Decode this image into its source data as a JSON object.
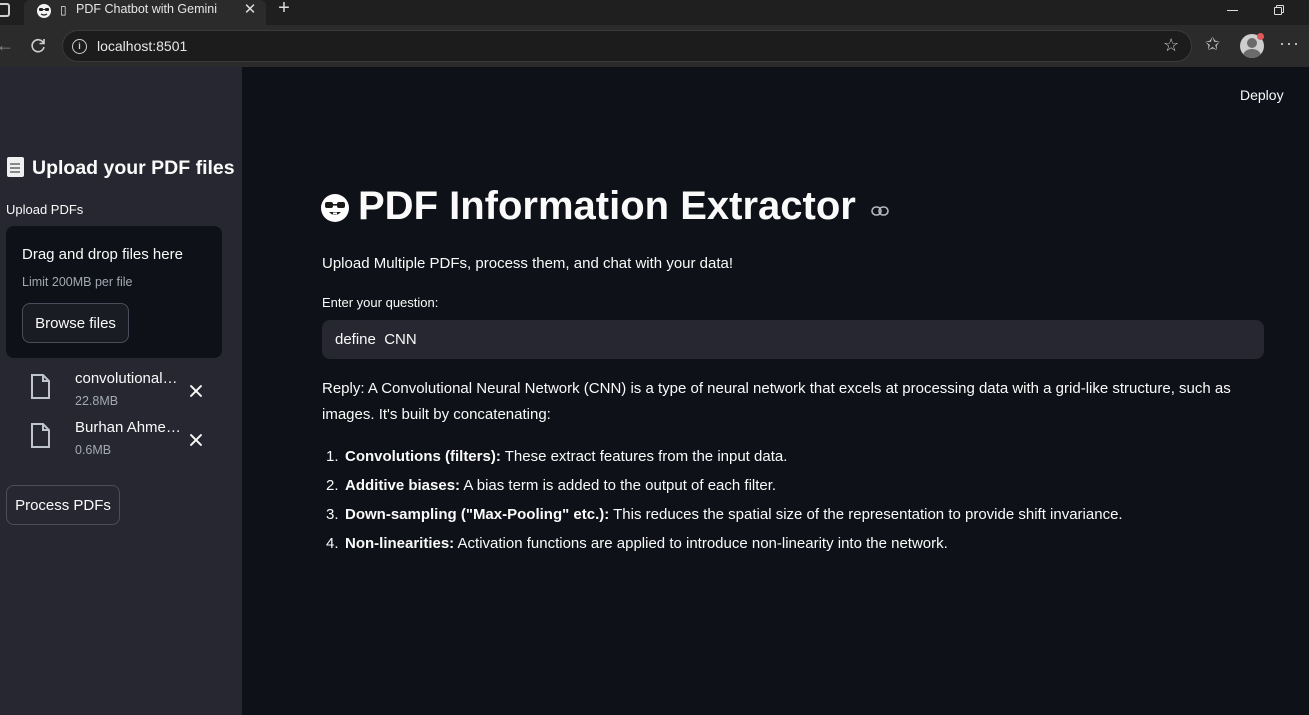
{
  "browser": {
    "tab_title": "PDF Chatbot with Gemini",
    "url": "localhost:8501"
  },
  "app": {
    "deploy_label": "Deploy",
    "sidebar": {
      "header": "Upload your PDF files",
      "upload_label": "Upload PDFs",
      "dropzone": {
        "title": "Drag and drop files here",
        "limit": "Limit 200MB per file",
        "browse_label": "Browse files"
      },
      "files": [
        {
          "name": "convolutional…",
          "size": "22.8MB"
        },
        {
          "name": "Burhan Ahme…",
          "size": "0.6MB"
        }
      ],
      "process_label": "Process PDFs"
    },
    "main": {
      "title": "PDF Information Extractor",
      "subtitle": "Upload Multiple PDFs, process them, and chat with your data!",
      "question_label": "Enter your question:",
      "question_value": "define  CNN",
      "reply": "Reply: A Convolutional Neural Network (CNN) is a type of neural network that excels at processing data with a grid-like structure, such as images. It's built by concatenating:",
      "steps": [
        {
          "num": "1.",
          "term": "Convolutions (filters):",
          "desc": " These extract features from the input data."
        },
        {
          "num": "2.",
          "term": "Additive biases:",
          "desc": " A bias term is added to the output of each filter."
        },
        {
          "num": "3.",
          "term": "Down-sampling (\"Max-Pooling\" etc.):",
          "desc": " This reduces the spatial size of the representation to provide shift invariance."
        },
        {
          "num": "4.",
          "term": "Non-linearities:",
          "desc": " Activation functions are applied to introduce non-linearity into the network."
        }
      ]
    }
  },
  "colors": {
    "app_bg": "#0e1117",
    "sidebar_bg": "#262730",
    "input_bg": "#262730",
    "text": "#fafafa",
    "muted_text": "#a3a8b4"
  }
}
